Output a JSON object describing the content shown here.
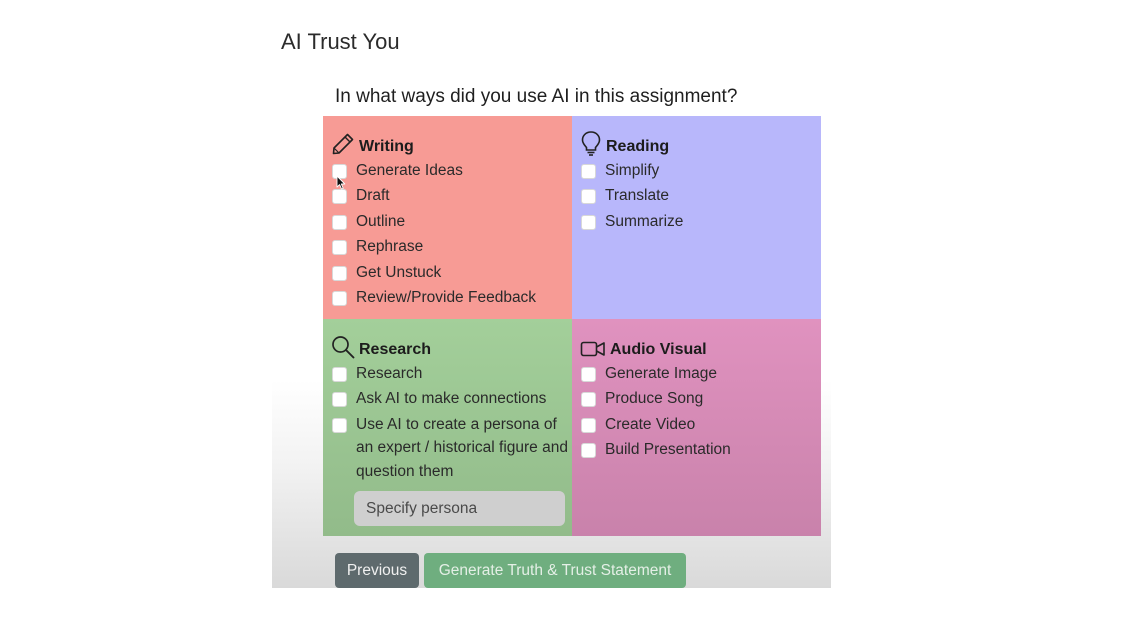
{
  "app_title": "AI Trust You",
  "question": "In what ways did you use AI in this assignment?",
  "sections": {
    "writing": {
      "title": "Writing",
      "icon": "pencil-icon",
      "color": "#f79b95",
      "options": [
        "Generate Ideas",
        "Draft",
        "Outline",
        "Rephrase",
        "Get Unstuck",
        "Review/Provide Feedback"
      ]
    },
    "reading": {
      "title": "Reading",
      "icon": "lightbulb-icon",
      "color": "#b8b7fb",
      "options": [
        "Simplify",
        "Translate",
        "Summarize"
      ]
    },
    "research": {
      "title": "Research",
      "icon": "magnifier-icon",
      "color": "#a3cf9a",
      "options": [
        "Research",
        "Ask AI to make connections",
        "Use AI to create a persona of an expert / historical figure and question them"
      ],
      "persona_placeholder": "Specify persona"
    },
    "audio_visual": {
      "title": "Audio Visual",
      "icon": "video-camera-icon",
      "color": "#e092bf",
      "options": [
        "Generate Image",
        "Produce Song",
        "Create Video",
        "Build Presentation"
      ]
    }
  },
  "buttons": {
    "previous": "Previous",
    "generate": "Generate Truth & Trust Statement"
  }
}
